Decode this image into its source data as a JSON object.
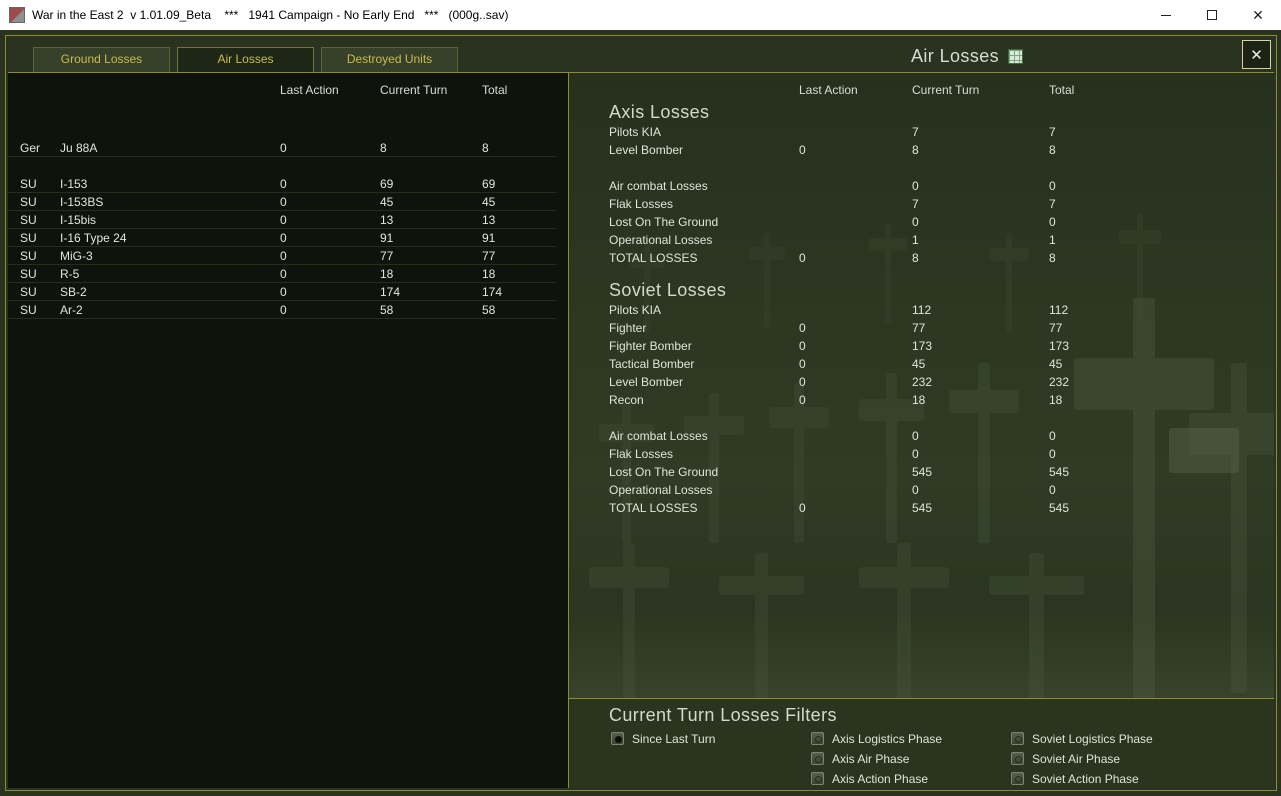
{
  "colors": {
    "accent_gold": "#8f8c2e",
    "tab_text_yellow": "#c9bc4a",
    "olive_background": "#2a331f",
    "panel_dark": "#0e140c",
    "text_light": "#e2e6dc",
    "titlebar_background": "#ffffff"
  },
  "titlebar": {
    "title": "War in the East 2  v 1.01.09_Beta    ***   1941 Campaign - No Early End   ***   (000g..sav)",
    "close_glyph": "✕"
  },
  "tabs": {
    "items": [
      {
        "label": "Ground Losses",
        "active": false
      },
      {
        "label": "Air Losses",
        "active": true
      },
      {
        "label": "Destroyed Units",
        "active": false
      }
    ]
  },
  "header": {
    "title": "Air Losses",
    "close_glyph": "✕"
  },
  "columns": {
    "last_action": "Last Action",
    "current_turn": "Current Turn",
    "total": "Total"
  },
  "left_table": {
    "rows": [
      {
        "nation": "Ger",
        "aircraft": "Ju 88A",
        "last_action": "0",
        "current_turn": "8",
        "total": "8"
      },
      {
        "nation": "SU",
        "aircraft": "I-153",
        "last_action": "0",
        "current_turn": "69",
        "total": "69"
      },
      {
        "nation": "SU",
        "aircraft": "I-153BS",
        "last_action": "0",
        "current_turn": "45",
        "total": "45"
      },
      {
        "nation": "SU",
        "aircraft": "I-15bis",
        "last_action": "0",
        "current_turn": "13",
        "total": "13"
      },
      {
        "nation": "SU",
        "aircraft": "I-16 Type 24",
        "last_action": "0",
        "current_turn": "91",
        "total": "91"
      },
      {
        "nation": "SU",
        "aircraft": "MiG-3",
        "last_action": "0",
        "current_turn": "77",
        "total": "77"
      },
      {
        "nation": "SU",
        "aircraft": "R-5",
        "last_action": "0",
        "current_turn": "18",
        "total": "18"
      },
      {
        "nation": "SU",
        "aircraft": "SB-2",
        "last_action": "0",
        "current_turn": "174",
        "total": "174"
      },
      {
        "nation": "SU",
        "aircraft": "Ar-2",
        "last_action": "0",
        "current_turn": "58",
        "total": "58"
      }
    ]
  },
  "axis_losses": {
    "title": "Axis Losses",
    "rows": [
      {
        "label": "Pilots KIA",
        "last_action": "",
        "current_turn": "7",
        "total": "7"
      },
      {
        "label": "Level Bomber",
        "last_action": "0",
        "current_turn": "8",
        "total": "8"
      },
      {
        "label": "Air combat Losses",
        "last_action": "",
        "current_turn": "0",
        "total": "0"
      },
      {
        "label": "Flak Losses",
        "last_action": "",
        "current_turn": "7",
        "total": "7"
      },
      {
        "label": "Lost On The Ground",
        "last_action": "",
        "current_turn": "0",
        "total": "0"
      },
      {
        "label": "Operational Losses",
        "last_action": "",
        "current_turn": "1",
        "total": "1"
      },
      {
        "label": "TOTAL LOSSES",
        "last_action": "0",
        "current_turn": "8",
        "total": "8"
      }
    ]
  },
  "soviet_losses": {
    "title": "Soviet Losses",
    "rows": [
      {
        "label": "Pilots KIA",
        "last_action": "",
        "current_turn": "112",
        "total": "112"
      },
      {
        "label": "Fighter",
        "last_action": "0",
        "current_turn": "77",
        "total": "77"
      },
      {
        "label": "Fighter Bomber",
        "last_action": "0",
        "current_turn": "173",
        "total": "173"
      },
      {
        "label": "Tactical Bomber",
        "last_action": "0",
        "current_turn": "45",
        "total": "45"
      },
      {
        "label": "Level Bomber",
        "last_action": "0",
        "current_turn": "232",
        "total": "232"
      },
      {
        "label": "Recon",
        "last_action": "0",
        "current_turn": "18",
        "total": "18"
      },
      {
        "label": "Air combat Losses",
        "last_action": "",
        "current_turn": "0",
        "total": "0"
      },
      {
        "label": "Flak Losses",
        "last_action": "",
        "current_turn": "0",
        "total": "0"
      },
      {
        "label": "Lost On The Ground",
        "last_action": "",
        "current_turn": "545",
        "total": "545"
      },
      {
        "label": "Operational Losses",
        "last_action": "",
        "current_turn": "0",
        "total": "0"
      },
      {
        "label": "TOTAL LOSSES",
        "last_action": "0",
        "current_turn": "545",
        "total": "545"
      }
    ]
  },
  "filters": {
    "title": "Current Turn Losses Filters",
    "since_last_turn": {
      "label": "Since Last Turn",
      "checked": true
    },
    "phases": [
      {
        "label": "Axis Logistics Phase",
        "checked": false
      },
      {
        "label": "Axis Air Phase",
        "checked": false
      },
      {
        "label": "Axis Action Phase",
        "checked": false
      },
      {
        "label": "Soviet Logistics Phase",
        "checked": false
      },
      {
        "label": "Soviet Air Phase",
        "checked": false
      },
      {
        "label": "Soviet Action Phase",
        "checked": false
      }
    ]
  }
}
